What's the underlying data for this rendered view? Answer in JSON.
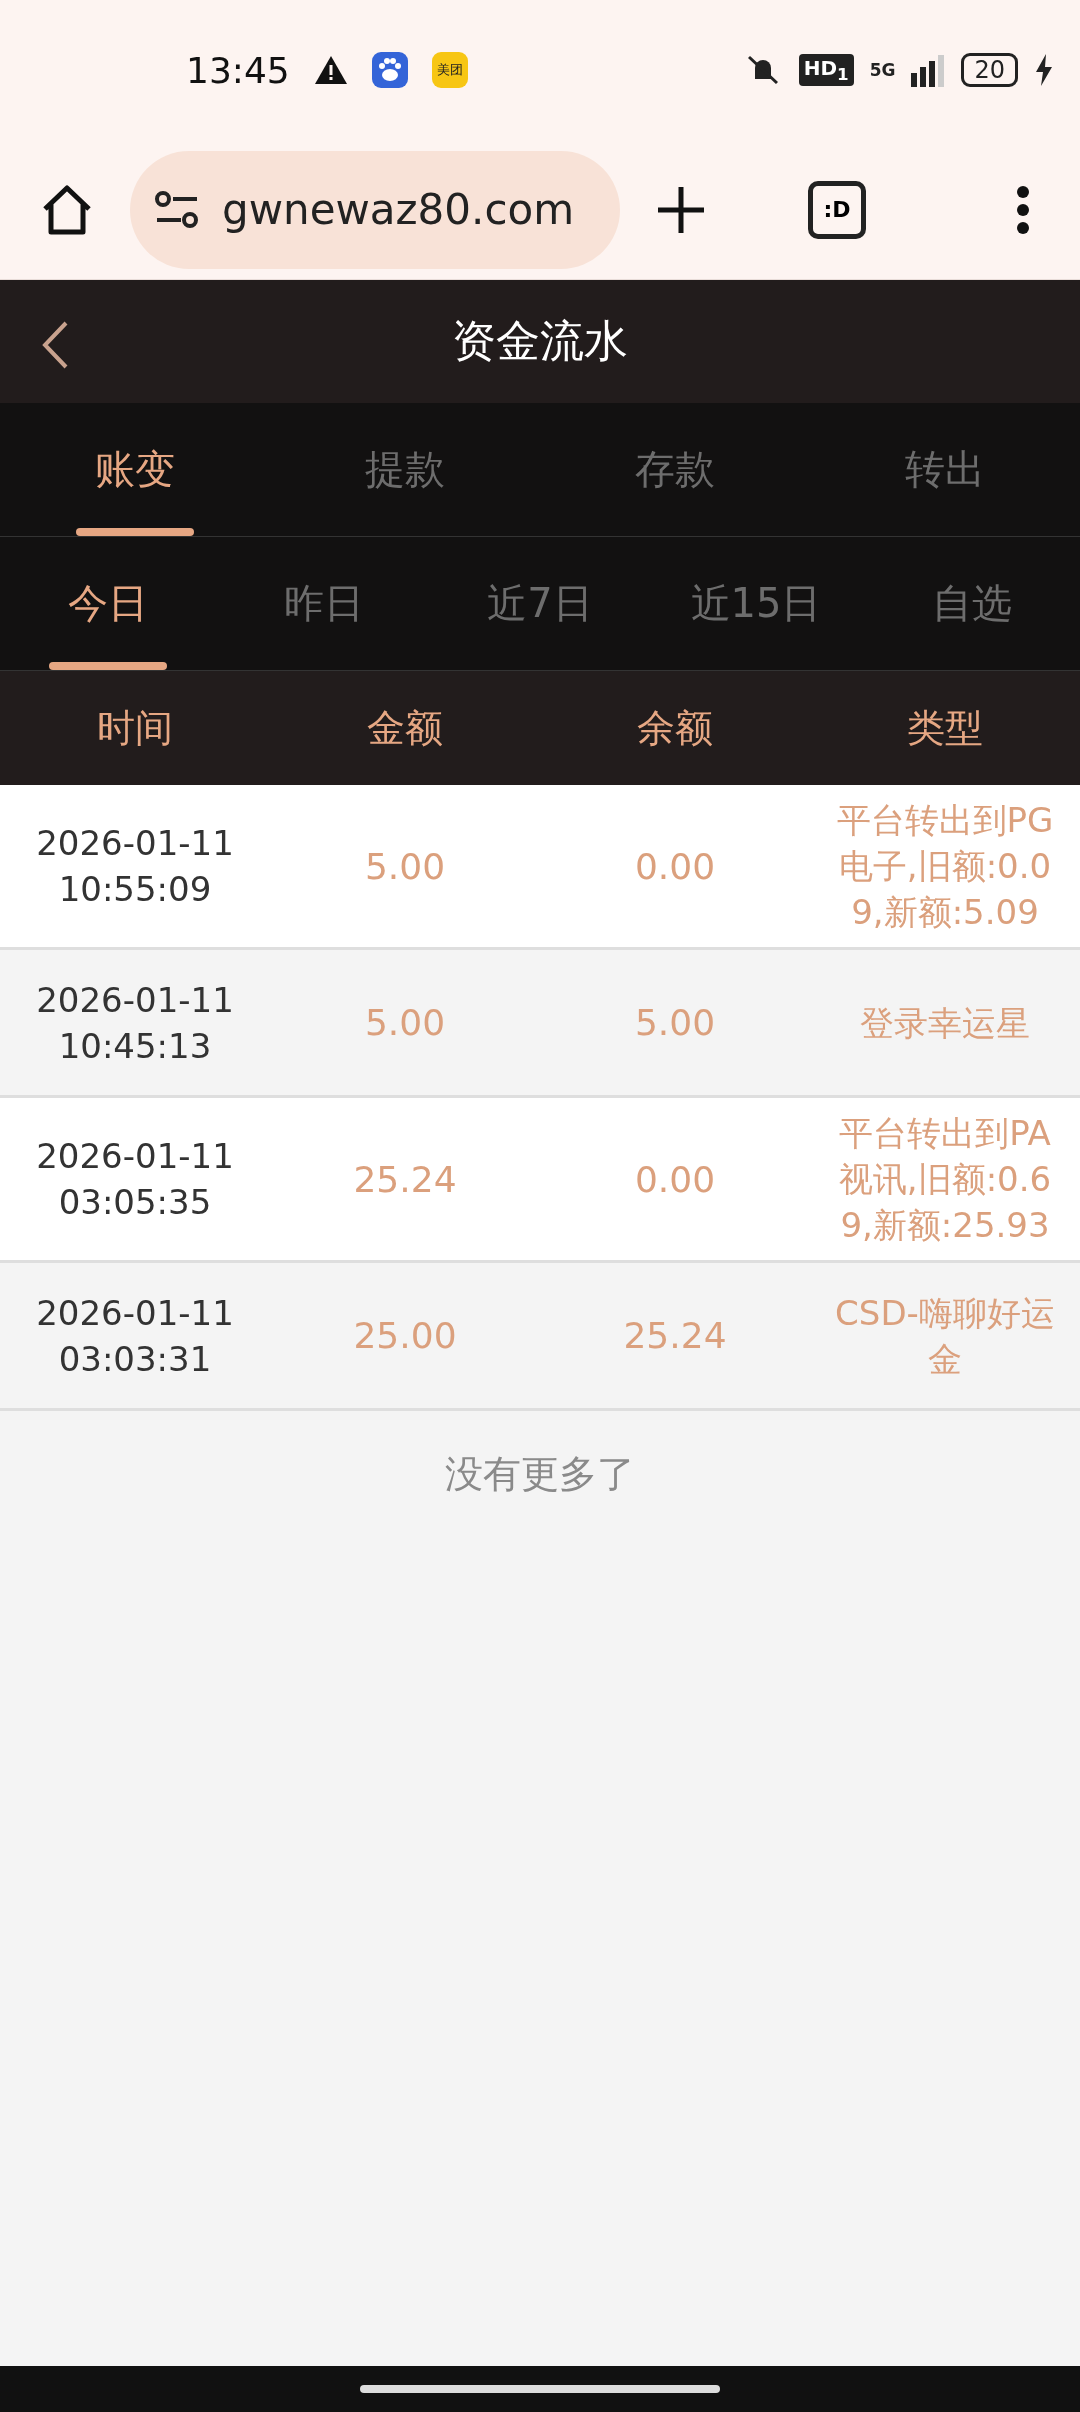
{
  "status_bar": {
    "time": "13:45",
    "app_badge": "美团",
    "hd_label": "HD$_{1}$",
    "network": "5G",
    "battery": "20"
  },
  "browser": {
    "url": "gwnewaz80.com",
    "tab_switcher": ":D"
  },
  "header": {
    "title": "资金流水"
  },
  "tabs": [
    {
      "label": "账变",
      "selected": true
    },
    {
      "label": "提款",
      "selected": false
    },
    {
      "label": "存款",
      "selected": false
    },
    {
      "label": "转出",
      "selected": false
    }
  ],
  "date_filters": [
    {
      "label": "今日",
      "selected": true
    },
    {
      "label": "昨日",
      "selected": false
    },
    {
      "label": "近7日",
      "selected": false
    },
    {
      "label": "近15日",
      "selected": false
    },
    {
      "label": "自选",
      "selected": false
    }
  ],
  "table": {
    "columns": [
      "时间",
      "金额",
      "余额",
      "类型"
    ],
    "rows": [
      {
        "date": "2026-01-11",
        "time": "10:55:09",
        "amount": "5.00",
        "balance": "0.00",
        "type": "平台转出到PG电子,旧额:0.09,新额:5.09"
      },
      {
        "date": "2026-01-11",
        "time": "10:45:13",
        "amount": "5.00",
        "balance": "5.00",
        "type": "登录幸运星"
      },
      {
        "date": "2026-01-11",
        "time": "03:05:35",
        "amount": "25.24",
        "balance": "0.00",
        "type": "平台转出到PA视讯,旧额:0.69,新额:25.93"
      },
      {
        "date": "2026-01-11",
        "time": "03:03:31",
        "amount": "25.00",
        "balance": "25.24",
        "type": "CSD-嗨聊好运金"
      }
    ]
  },
  "end_note": "没有更多了"
}
